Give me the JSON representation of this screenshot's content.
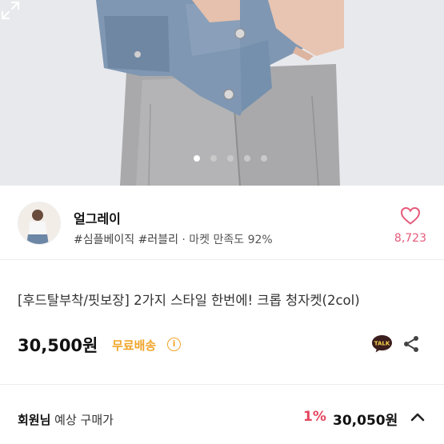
{
  "gallery": {
    "page_count": 5,
    "active_index": 0,
    "expand_icon": "expand-icon"
  },
  "shop": {
    "name": "얼그레이",
    "tags": "#심플베이직 #러블리",
    "satisfaction": "· 마켓 만족도 92%",
    "likes": "8,723",
    "heart_icon": "heart-outline-icon"
  },
  "product": {
    "title": "[후드탈부착/핏보장] 2가지 스타일 한번에! 크롭 청자켓(2col)",
    "price": "30,500원",
    "shipping": "무료배송",
    "info_icon_glyph": "i",
    "talk_label": "TALK"
  },
  "member_price": {
    "label_bold": "회원님",
    "label_rest": " 예상 구매가",
    "discount": "1%",
    "price": "30,050원"
  },
  "colors": {
    "accent_pink": "#e55a7a",
    "discount_red": "#e5465f",
    "shipping_orange": "#f0a52b",
    "kakao_yellow": "#3c1e1e"
  }
}
